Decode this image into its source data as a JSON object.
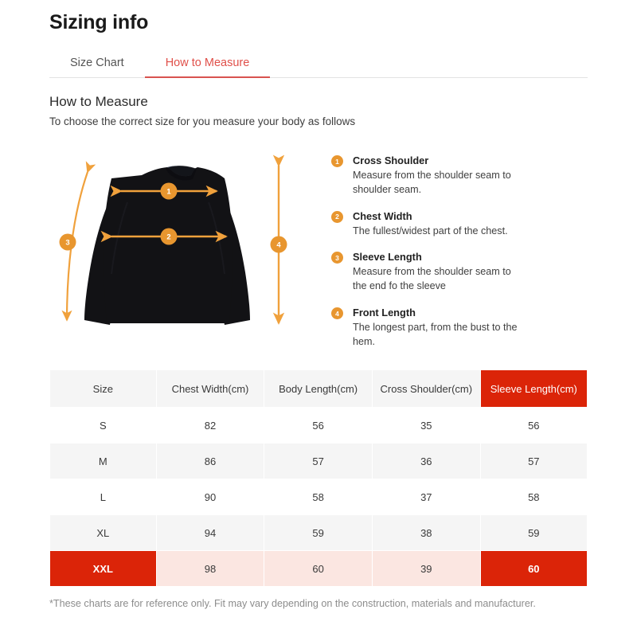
{
  "page_title": "Sizing info",
  "tabs": [
    {
      "label": "Size Chart",
      "active": false
    },
    {
      "label": "How to Measure",
      "active": true
    }
  ],
  "section": {
    "title": "How to Measure",
    "subtitle": "To choose the correct size for you measure your body as follows"
  },
  "illustration": {
    "alt": "black long sleeve crewneck sweater with measurement arrows",
    "arrow_labels": [
      "1",
      "2",
      "3",
      "4"
    ]
  },
  "legend": [
    {
      "num": "1",
      "title": "Cross Shoulder",
      "desc": "Measure from the shoulder seam to shoulder seam."
    },
    {
      "num": "2",
      "title": "Chest Width",
      "desc": "The fullest/widest part of the chest."
    },
    {
      "num": "3",
      "title": "Sleeve Length",
      "desc": "Measure from the shoulder seam to the end fo the sleeve"
    },
    {
      "num": "4",
      "title": "Front Length",
      "desc": "The longest part, from the bust to the hem."
    }
  ],
  "table": {
    "columns": [
      "Size",
      "Chest Width(cm)",
      "Body Length(cm)",
      "Cross Shoulder(cm)",
      "Sleeve Length(cm)"
    ],
    "highlight_column_index": 4,
    "highlight_row_index": 4,
    "rows": [
      [
        "S",
        "82",
        "56",
        "35",
        "56"
      ],
      [
        "M",
        "86",
        "57",
        "36",
        "57"
      ],
      [
        "L",
        "90",
        "58",
        "37",
        "58"
      ],
      [
        "XL",
        "94",
        "59",
        "38",
        "59"
      ],
      [
        "XXL",
        "98",
        "60",
        "39",
        "60"
      ]
    ]
  },
  "footnote": "*These charts are for reference only. Fit may vary depending on the construction, materials and manufacturer.",
  "colors": {
    "tab_accent": "#d9534f",
    "table_highlight": "#db2408",
    "table_highlight_soft": "#fbe6e1",
    "badge_orange": "#e8962f",
    "row_stripe": "#f5f5f5"
  }
}
